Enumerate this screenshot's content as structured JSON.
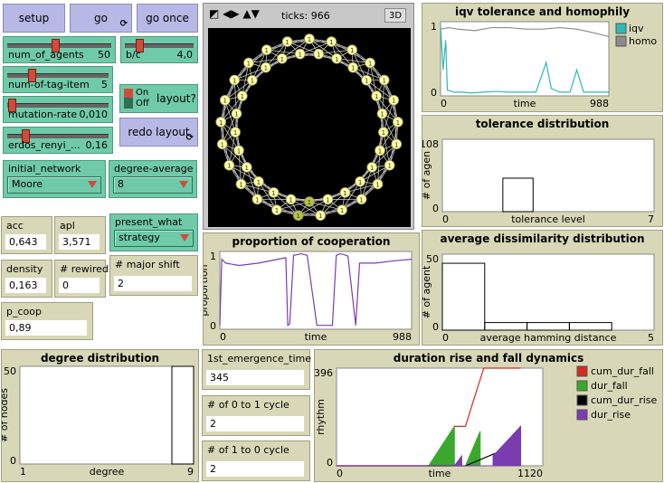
{
  "buttons": {
    "setup": "setup",
    "go": "go",
    "go_once": "go once",
    "redo_layout": "redo layout"
  },
  "sliders": {
    "num_of_agents": {
      "name": "num_of_agents",
      "value": "50",
      "fraction": 0.5
    },
    "b_c": {
      "name": "b/c",
      "value": "4,0",
      "fraction": 0.2
    },
    "num_of_tag_item": {
      "name": "num-of-tag-item",
      "value": "5",
      "fraction": 0.25
    },
    "mutation_rate": {
      "name": "mutation-rate",
      "value": "0,010",
      "fraction": 0.01
    },
    "erdos_renyi": {
      "name": "erdos_renyi_...",
      "value": "0,16",
      "fraction": 0.16
    }
  },
  "switch_layout": {
    "on": "On",
    "off": "Off",
    "label": "layout?"
  },
  "choosers": {
    "initial_network": {
      "label": "initial_network",
      "value": "Moore"
    },
    "degree_average": {
      "label": "degree-average",
      "value": "8"
    },
    "present_what": {
      "label": "present_what",
      "value": "strategy"
    }
  },
  "monitors": {
    "acc": {
      "label": "acc",
      "value": "0,643"
    },
    "apl": {
      "label": "apl",
      "value": "3,571"
    },
    "density": {
      "label": "density",
      "value": "0,163"
    },
    "rewired": {
      "label": "# rewired",
      "value": "0"
    },
    "major_shift": {
      "label": "# major shift",
      "value": "2"
    },
    "p_coop": {
      "label": "p_coop",
      "value": "0,89"
    },
    "first_emergence": {
      "label": "1st_emergence_time",
      "value": "345"
    },
    "cycle_0_1": {
      "label": "# of 0 to 1 cycle",
      "value": "2"
    },
    "cycle_1_0": {
      "label": "# of 1 to 0 cycle",
      "value": "2"
    }
  },
  "view": {
    "ticks_label": "ticks: 966",
    "btn_3d": "3D",
    "agent_count": 50
  },
  "plots": {
    "iqv": {
      "title": "iqv tolerance and homophily",
      "xlabel": "time",
      "xmin": "0",
      "xmax": "988",
      "ymin": "0",
      "ymax": "1",
      "legend": [
        {
          "name": "iqv",
          "color": "#2fb8b8"
        },
        {
          "name": "homo",
          "color": "#8c8c8c"
        }
      ]
    },
    "tolerance": {
      "title": "tolerance distribution",
      "xlabel": "tolerance level",
      "ylabel": "# of agen",
      "xmin": "0",
      "xmax": "7",
      "ymin": "0",
      "ymax": "108"
    },
    "cooperation": {
      "title": "proportion of cooperation",
      "xlabel": "time",
      "ylabel": "proportion",
      "xmin": "0",
      "xmax": "988",
      "ymin": "0",
      "ymax": "1"
    },
    "dissimilarity": {
      "title": "average dissimilarity distribution",
      "xlabel": "average hamming distance",
      "ylabel": "# of agent",
      "xmin": "0",
      "xmax": "5",
      "ymin": "0",
      "ymax": "50"
    },
    "degree": {
      "title": "degree distribution",
      "xlabel": "degree",
      "ylabel": "# of nodes",
      "xmin": "1",
      "xmax": "9",
      "ymin": "0",
      "ymax": "50"
    },
    "duration": {
      "title": "duration rise and fall dynamics",
      "xlabel": "time",
      "ylabel": "rhythm",
      "xmin": "0",
      "xmax": "1120",
      "ymin": "0",
      "ymax": "396",
      "legend": [
        {
          "name": "cum_dur_fall",
          "color": "#d52a1e"
        },
        {
          "name": "dur_fall",
          "color": "#3aa82c"
        },
        {
          "name": "cum_dur_rise",
          "color": "#000000"
        },
        {
          "name": "dur_rise",
          "color": "#7a3cae"
        }
      ]
    }
  },
  "chart_data": [
    {
      "type": "line",
      "title": "iqv tolerance and homophily",
      "xlabel": "time",
      "ylim": [
        0,
        1
      ],
      "xlim": [
        0,
        988
      ],
      "series": [
        {
          "name": "iqv",
          "x": [
            0,
            15,
            30,
            40,
            80,
            120,
            180,
            250,
            330,
            400,
            480,
            560,
            620,
            650,
            700,
            760,
            800,
            840,
            880,
            920,
            988
          ],
          "y": [
            0.95,
            0.35,
            0.75,
            0.08,
            0.05,
            0.05,
            0.04,
            0.05,
            0.06,
            0.05,
            0.05,
            0.05,
            0.45,
            0.1,
            0.05,
            0.05,
            0.35,
            0.05,
            0.05,
            0.05,
            0.05
          ]
        },
        {
          "name": "homo",
          "x": [
            0,
            50,
            100,
            200,
            300,
            400,
            500,
            600,
            700,
            800,
            900,
            988
          ],
          "y": [
            0.9,
            0.92,
            0.9,
            0.88,
            0.92,
            0.92,
            0.9,
            0.9,
            0.92,
            0.9,
            0.85,
            0.8
          ]
        }
      ]
    },
    {
      "type": "bar",
      "title": "tolerance distribution",
      "xlabel": "tolerance level",
      "ylabel": "# of agen",
      "xlim": [
        0,
        7
      ],
      "ylim": [
        0,
        108
      ],
      "categories": [
        2
      ],
      "values": [
        50
      ]
    },
    {
      "type": "line",
      "title": "proportion of cooperation",
      "xlabel": "time",
      "ylabel": "proportion",
      "xlim": [
        0,
        988
      ],
      "ylim": [
        0,
        1
      ],
      "series": [
        {
          "name": "",
          "x": [
            0,
            10,
            30,
            100,
            200,
            340,
            350,
            360,
            380,
            420,
            450,
            500,
            580,
            600,
            620,
            640,
            660,
            700,
            720,
            800,
            900,
            988
          ],
          "y": [
            0.05,
            0.9,
            0.85,
            0.82,
            0.85,
            0.92,
            0.05,
            0.07,
            0.95,
            0.97,
            0.95,
            0.05,
            0.05,
            0.95,
            0.97,
            0.96,
            0.94,
            0.05,
            0.85,
            0.85,
            0.88,
            0.9
          ]
        }
      ]
    },
    {
      "type": "bar",
      "title": "average dissimilarity distribution",
      "xlabel": "average hamming distance",
      "ylabel": "# of agent",
      "xlim": [
        0,
        5
      ],
      "ylim": [
        0,
        50
      ],
      "categories": [
        0,
        1,
        2,
        3
      ],
      "values": [
        44,
        5,
        5,
        5
      ]
    },
    {
      "type": "bar",
      "title": "degree distribution",
      "xlabel": "degree",
      "ylabel": "# of nodes",
      "xlim": [
        1,
        9
      ],
      "ylim": [
        0,
        50
      ],
      "categories": [
        8
      ],
      "values": [
        50
      ]
    },
    {
      "type": "area",
      "title": "duration rise and fall dynamics",
      "xlabel": "time",
      "ylabel": "rhythm",
      "xlim": [
        0,
        1120
      ],
      "ylim": [
        0,
        396
      ],
      "series": [
        {
          "name": "cum_dur_fall",
          "x": [
            0,
            600,
            640,
            700,
            750,
            800,
            1000
          ],
          "y": [
            0,
            0,
            160,
            160,
            280,
            396,
            396
          ]
        },
        {
          "name": "dur_fall",
          "x": [
            0,
            500,
            640,
            640,
            700,
            780,
            780
          ],
          "y": [
            0,
            0,
            160,
            0,
            0,
            140,
            0
          ]
        },
        {
          "name": "cum_dur_rise",
          "x": [
            0,
            700,
            860,
            900,
            1000
          ],
          "y": [
            0,
            0,
            50,
            50,
            160
          ]
        },
        {
          "name": "dur_rise",
          "x": [
            0,
            640,
            680,
            680,
            850,
            850,
            1000,
            1000
          ],
          "y": [
            0,
            0,
            40,
            0,
            0,
            40,
            160,
            0
          ]
        }
      ]
    }
  ]
}
